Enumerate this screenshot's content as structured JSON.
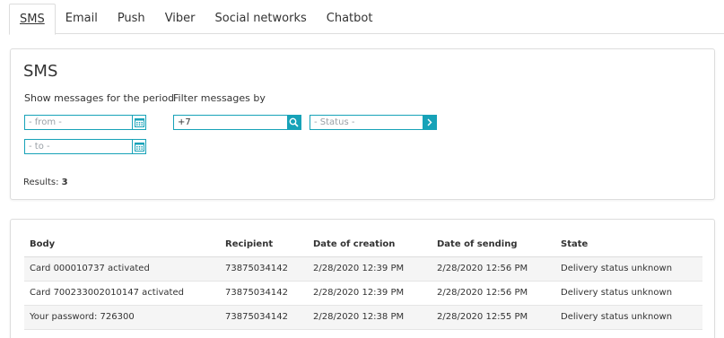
{
  "tabs": [
    {
      "label": "SMS",
      "active": true
    },
    {
      "label": "Email"
    },
    {
      "label": "Push"
    },
    {
      "label": "Viber"
    },
    {
      "label": "Social networks"
    },
    {
      "label": "Chatbot"
    }
  ],
  "filter": {
    "title": "SMS",
    "period_label": "Show messages for the period",
    "filter_label": "Filter messages by",
    "from_placeholder": "- from -",
    "to_placeholder": "- to -",
    "phone_value": "+7",
    "status_placeholder": "- Status -",
    "results_label": "Results:",
    "results_count": "3"
  },
  "table": {
    "headers": [
      "Body",
      "Recipient",
      "Date of creation",
      "Date of sending",
      "State"
    ],
    "rows": [
      [
        "Card 000010737 activated",
        "73875034142",
        "2/28/2020 12:39 PM",
        "2/28/2020 12:56 PM",
        "Delivery status unknown"
      ],
      [
        "Card 700233002010147 activated",
        "73875034142",
        "2/28/2020 12:39 PM",
        "2/28/2020 12:56 PM",
        "Delivery status unknown"
      ],
      [
        "Your password: 726300",
        "73875034142",
        "2/28/2020 12:38 PM",
        "2/28/2020 12:55 PM",
        "Delivery status unknown"
      ]
    ]
  },
  "colors": {
    "accent": "#17a2b8",
    "border": "#dddddd",
    "row_alt": "#f5f5f5"
  },
  "icons": {
    "calendar": "calendar-icon",
    "search": "search-icon",
    "chevron": "chevron-right-icon"
  }
}
